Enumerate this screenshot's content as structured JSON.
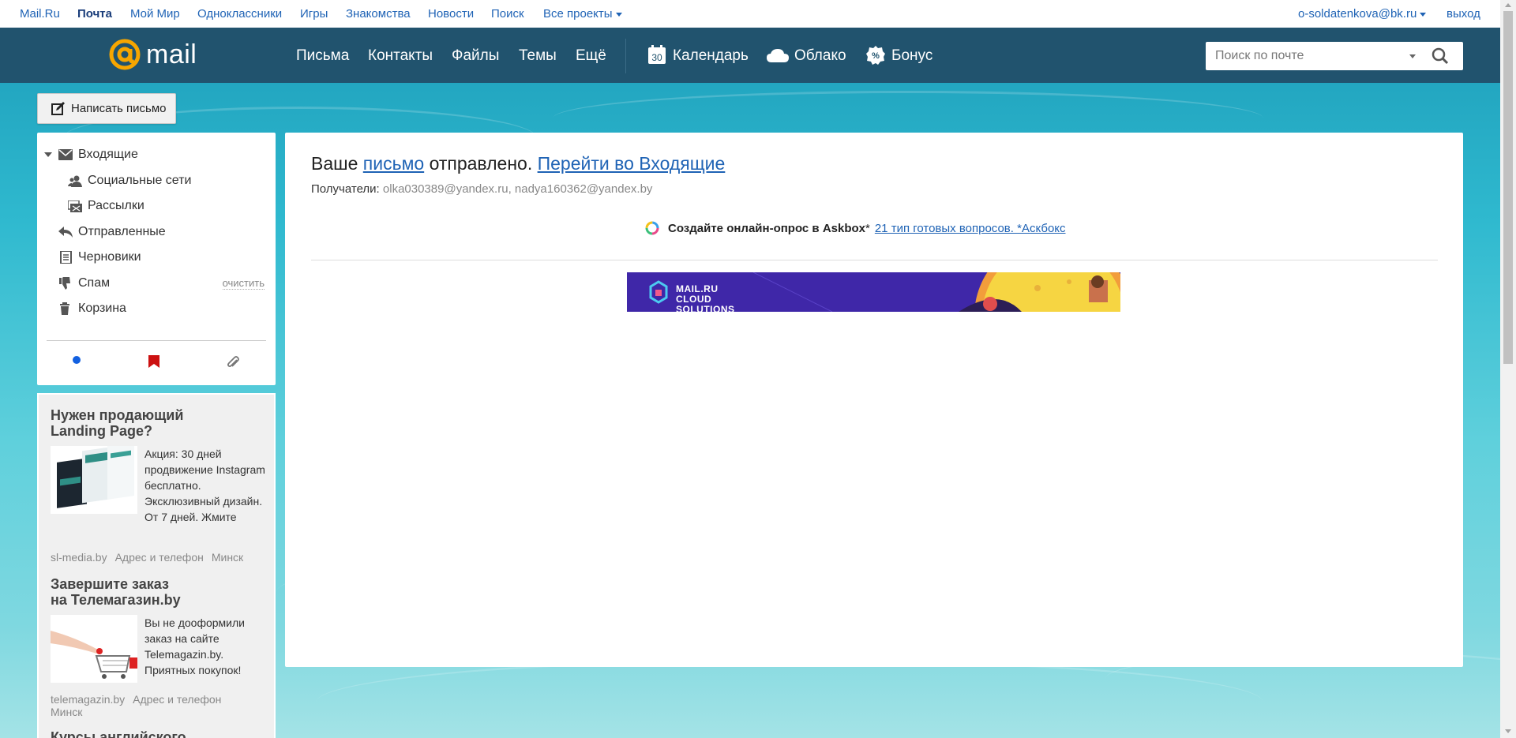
{
  "portal": {
    "links": [
      "Mail.Ru",
      "Почта",
      "Мой Мир",
      "Одноклассники",
      "Игры",
      "Знакомства",
      "Новости",
      "Поиск",
      "Все проекты"
    ],
    "account": "o-soldatenkova@bk.ru",
    "logout": "выход"
  },
  "header": {
    "logo_word": "mail",
    "nav": [
      "Письма",
      "Контакты",
      "Файлы",
      "Темы",
      "Ещё"
    ],
    "calendar_day": "30",
    "calendar": "Календарь",
    "cloud": "Облако",
    "bonus": "Бонус",
    "search_placeholder": "Поиск по почте"
  },
  "compose_label": "Написать письмо",
  "folders": {
    "inbox": "Входящие",
    "social": "Социальные сети",
    "newsletters": "Рассылки",
    "sent": "Отправленные",
    "drafts": "Черновики",
    "spam": "Спам",
    "spam_clear": "очистить",
    "trash": "Корзина"
  },
  "ads": [
    {
      "title_1": "Нужен продающий",
      "title_2": "Landing Page?",
      "text": "Акция: 30 дней продвижение Instagram бесплатно. Эксклюзивный дизайн. От 7 дней. Жмите",
      "domain": "sl-media.by",
      "contacts": "Адрес и телефон",
      "city": "Минск"
    },
    {
      "title_1": "Завершите заказ",
      "title_2": "на Телемагазин.by",
      "text": "Вы не дооформили заказ на сайте Telemagazin.by. Приятных покупок!",
      "domain": "telemagazin.by",
      "contacts": "Адрес и телефон",
      "city": "Минск"
    },
    {
      "title_1": "Курсы английского"
    }
  ],
  "main": {
    "sent_prefix": "Ваше",
    "sent_link": "письмо",
    "sent_mid": "отправлено.",
    "goto_inbox": "Перейти во Входящие",
    "recipients_label": "Получатели:",
    "recipients": "olka030389@yandex.ru, nadya160362@yandex.by",
    "promo_bold": "Создайте онлайн-опрос в Askbox",
    "promo_star": "*",
    "promo_link": "21 тип готовых вопросов. *Аскбокс",
    "banner_text_1": "MAIL.RU",
    "banner_text_2": "CLOUD",
    "banner_text_3": "SOLUTIONS"
  },
  "colors": {
    "header_bg": "#21536e",
    "link": "#1f63b5",
    "logo_orange": "#f7a600"
  }
}
